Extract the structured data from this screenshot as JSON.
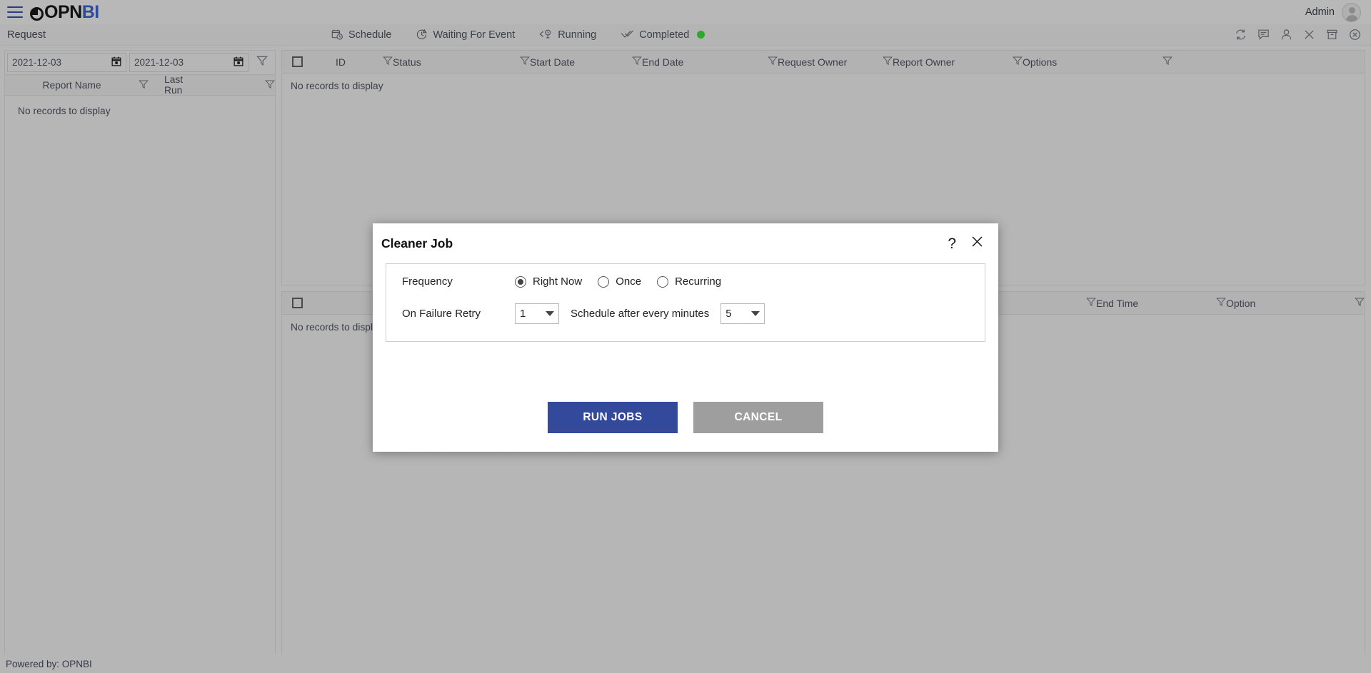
{
  "app": {
    "logo_text_dark": "OPN",
    "logo_text_accent": "BI",
    "accent_color": "#2d4b9a",
    "user_label": "Admin",
    "footer_text": "Powered by: OPNBI"
  },
  "subheader": {
    "breadcrumb": "Request",
    "tabs": [
      {
        "label": "Schedule",
        "icon": "calendar-clock-icon"
      },
      {
        "label": "Waiting For Event",
        "icon": "clock-icon"
      },
      {
        "label": "Running",
        "icon": "running-clock-icon"
      },
      {
        "label": "Completed",
        "icon": "double-check-icon",
        "status_color": "#2fa82f"
      }
    ],
    "tools": [
      {
        "name": "refresh-icon"
      },
      {
        "name": "comment-icon"
      },
      {
        "name": "user-icon"
      },
      {
        "name": "close-icon"
      },
      {
        "name": "archive-icon"
      },
      {
        "name": "circle-close-icon"
      }
    ]
  },
  "left_panel": {
    "date_from": "2021-12-03",
    "date_to": "2021-12-03",
    "columns": [
      "Report Name",
      "Last Run"
    ],
    "empty_text": "No records to display"
  },
  "top_table": {
    "columns": [
      "ID",
      "Status",
      "Start Date",
      "End Date",
      "Request Owner",
      "Report Owner",
      "Options"
    ],
    "empty_text": "No records to display"
  },
  "bottom_table": {
    "columns": [
      "End Time",
      "Option"
    ],
    "empty_text": "No records to display"
  },
  "modal": {
    "title": "Cleaner Job",
    "help_label": "?",
    "close_label": "✕",
    "frequency_label": "Frequency",
    "frequency_options": [
      {
        "label": "Right Now",
        "selected": true
      },
      {
        "label": "Once",
        "selected": false
      },
      {
        "label": "Recurring",
        "selected": false
      }
    ],
    "retry_label": "On Failure Retry",
    "retry_value": "1",
    "schedule_label": "Schedule after every minutes",
    "schedule_value": "5",
    "run_label": "RUN JOBS",
    "cancel_label": "CANCEL",
    "primary_color": "#33499c",
    "secondary_color": "#9e9e9e"
  }
}
